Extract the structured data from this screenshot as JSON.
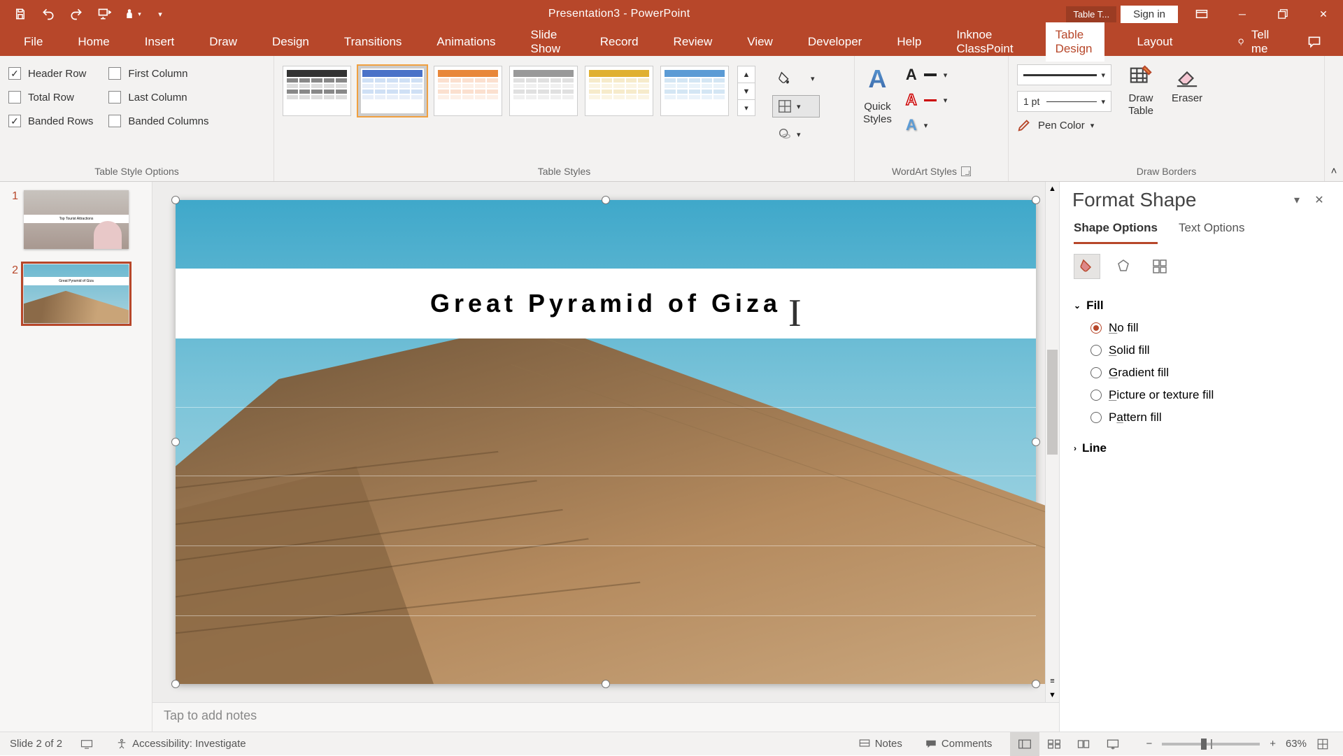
{
  "titlebar": {
    "app_title": "Presentation3  -  PowerPoint",
    "table_tools": "Table T...",
    "signin": "Sign in"
  },
  "tabs": {
    "file": "File",
    "home": "Home",
    "insert": "Insert",
    "draw": "Draw",
    "design": "Design",
    "transitions": "Transitions",
    "animations": "Animations",
    "slideshow": "Slide Show",
    "record": "Record",
    "review": "Review",
    "view": "View",
    "developer": "Developer",
    "help": "Help",
    "classpoint": "Inknoe ClassPoint",
    "table_design": "Table Design",
    "layout": "Layout",
    "tellme": "Tell me"
  },
  "ribbon": {
    "tso": {
      "header_row": "Header Row",
      "total_row": "Total Row",
      "banded_rows": "Banded Rows",
      "first_column": "First Column",
      "last_column": "Last Column",
      "banded_columns": "Banded Columns",
      "group": "Table Style Options"
    },
    "styles_group": "Table Styles",
    "wordart": {
      "quick": "Quick\nStyles",
      "group": "WordArt Styles"
    },
    "borders": {
      "pen_weight": "1 pt",
      "pen_color": "Pen Color",
      "draw_table": "Draw\nTable",
      "eraser": "Eraser",
      "group": "Draw Borders"
    }
  },
  "thumbs": {
    "n1": "1",
    "n2": "2",
    "t1_band": "Top Tourist Attractions",
    "t2_band": "Great Pyramid of Giza"
  },
  "slide": {
    "title": "Great Pyramid of Giza"
  },
  "notes": {
    "placeholder": "Tap to add notes"
  },
  "pane": {
    "title": "Format Shape",
    "tabs": {
      "shape": "Shape Options",
      "text": "Text Options"
    },
    "sections": {
      "fill": "Fill",
      "line": "Line"
    },
    "fill": {
      "nofill": "No fill",
      "solid": "Solid fill",
      "gradient": "Gradient fill",
      "picture": "Picture or texture fill",
      "pattern": "Pattern fill"
    }
  },
  "status": {
    "slide": "Slide 2 of 2",
    "access": "Accessibility: Investigate",
    "notes": "Notes",
    "comments": "Comments",
    "zoom": "63%"
  }
}
